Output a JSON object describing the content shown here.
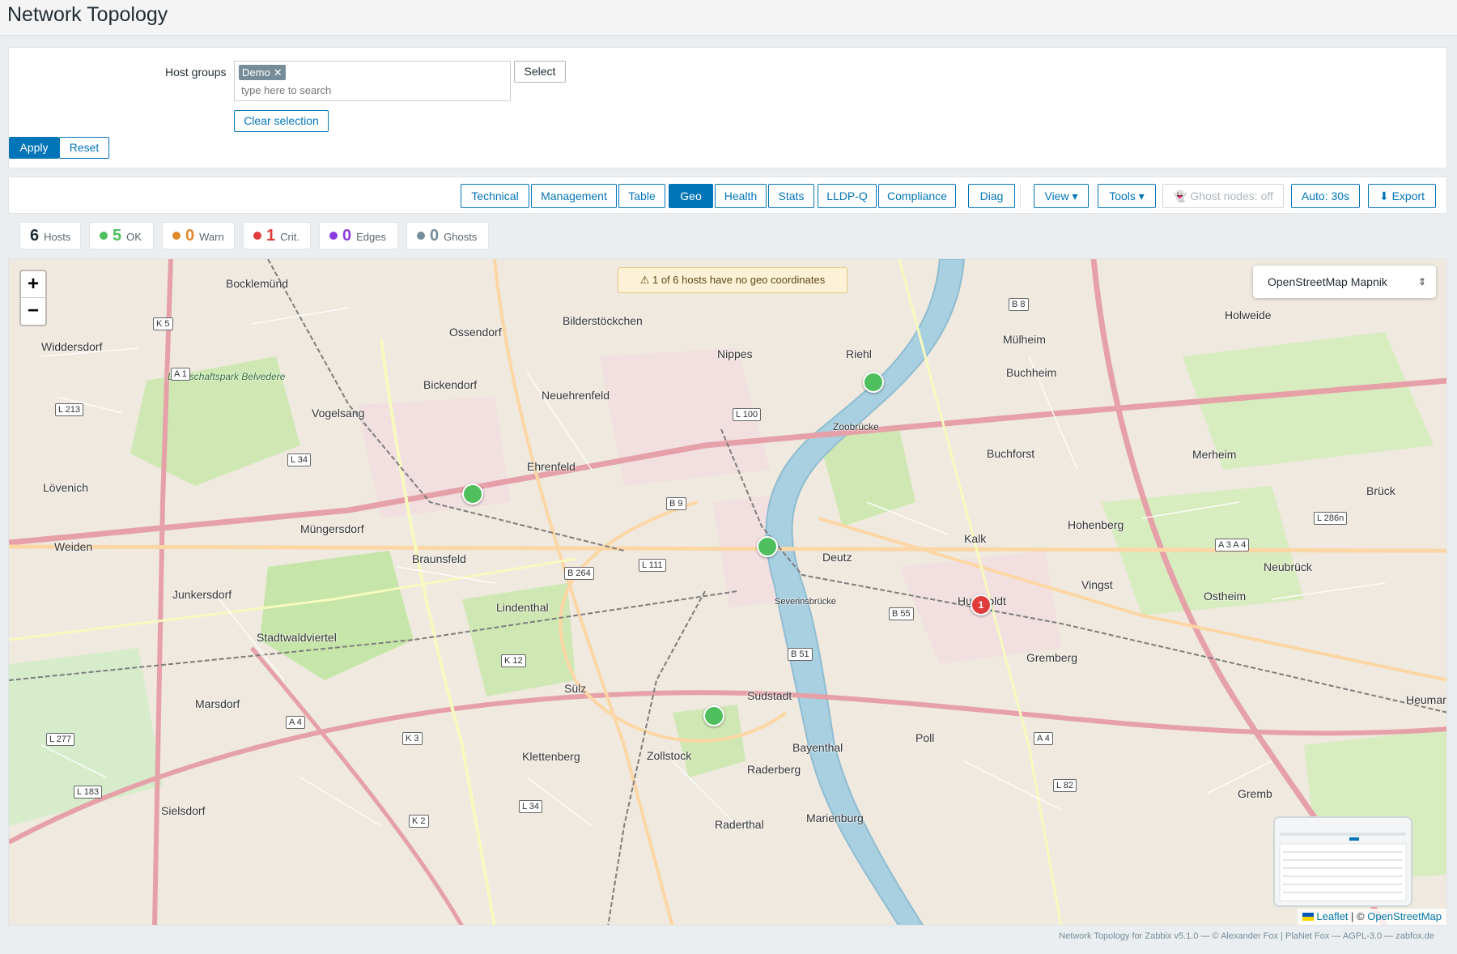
{
  "page": {
    "title": "Network Topology"
  },
  "filter": {
    "host_groups_label": "Host groups",
    "selected_chips": [
      "Demo"
    ],
    "chip_remove_glyph": "✕",
    "search_placeholder": "type here to search",
    "select_label": "Select",
    "clear_selection_label": "Clear selection",
    "apply_label": "Apply",
    "reset_label": "Reset"
  },
  "toolbar": {
    "views": [
      {
        "label": "Technical",
        "active": false
      },
      {
        "label": "Management",
        "active": false
      },
      {
        "label": "Table",
        "active": false
      },
      {
        "label": "Geo",
        "active": true
      },
      {
        "label": "Health",
        "active": false
      },
      {
        "label": "Stats",
        "active": false
      },
      {
        "label": "LLDP-Q",
        "active": false
      },
      {
        "label": "Compliance",
        "active": false
      },
      {
        "label": "Diag",
        "active": false
      }
    ],
    "view_menu_label": "View ▾",
    "tools_menu_label": "Tools ▾",
    "ghost_nodes_label": "👻 Ghost nodes: off",
    "auto_refresh_label": "Auto: 30s",
    "export_label": "⬇ Export"
  },
  "stats": [
    {
      "value": "6",
      "label": "Hosts",
      "color": ""
    },
    {
      "value": "5",
      "label": "OK",
      "color": "#4fbf5e"
    },
    {
      "value": "0",
      "label": "Warn",
      "color": "#e08a2c"
    },
    {
      "value": "1",
      "label": "Crit.",
      "color": "#e03c3c"
    },
    {
      "value": "0",
      "label": "Edges",
      "color": "#8a3ce0"
    },
    {
      "value": "0",
      "label": "Ghosts",
      "color": "#768d99"
    }
  ],
  "map": {
    "warning_text": "⚠ 1 of 6 hosts have no geo coordinates",
    "layer_selected": "OpenStreetMap Mapnik",
    "zoom_in": "+",
    "zoom_out": "−",
    "crit_marker_label": "1",
    "attribution_leaflet": "Leaflet",
    "attribution_sep": " | © ",
    "attribution_osm": "OpenStreetMap",
    "place_labels": [
      "Bocklemünd",
      "Bilderstöckchen",
      "Ossendorf",
      "Nippes",
      "Riehl",
      "Mülheim",
      "Holweide",
      "Widdersdorf",
      "Landschaftspark Belvedere",
      "Bickendorf",
      "Neuehrenfeld",
      "Buchheim",
      "Vogelsang",
      "Zoobrücke",
      "Merheim",
      "Buchforst",
      "Lövenich",
      "Ehrenfeld",
      "Brück",
      "Müngersdorf",
      "Kalk",
      "Weiden",
      "Braunsfeld",
      "Deutz",
      "Hohenberg",
      "Neubrück",
      "Junkersdorf",
      "Lindenthal",
      "Vingst",
      "Ostheim",
      "Stadtwaldviertel",
      "Severinsbrücke",
      "Humboldt",
      "Gremberg",
      "Marsdorf",
      "Sülz",
      "Sudstadt",
      "Heumar",
      "Poll",
      "Klettenberg",
      "Zollstock",
      "Bayenthal",
      "Raderberg",
      "Sielsdorf",
      "Raderthal",
      "Marienburg",
      "Gremb"
    ],
    "road_labels": [
      "K 5",
      "A 1",
      "L 213",
      "L 34",
      "L 100",
      "B 9",
      "B 8",
      "B 264",
      "L 111",
      "B 55",
      "B 51",
      "K 12",
      "A 4",
      "K 3",
      "L 277",
      "L 183",
      "L 34",
      "K 2",
      "A 4",
      "L 82",
      "L 286n",
      "A 3 A 4"
    ]
  },
  "footer": {
    "text": "Network Topology for Zabbix v5.1.0 — © Alexander Fox | PlaNet Fox — AGPL-3.0 — zabfox.de"
  }
}
